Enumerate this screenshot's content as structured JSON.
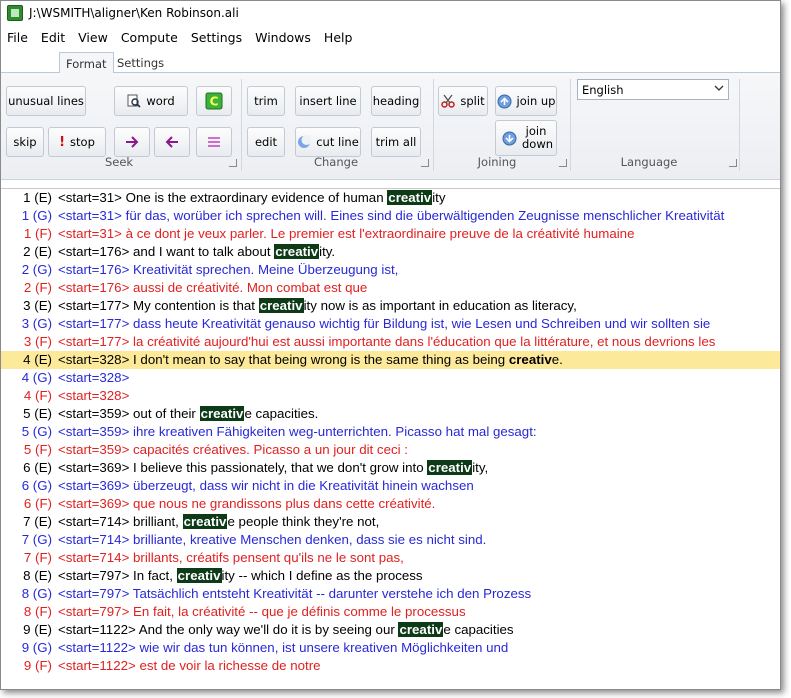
{
  "window": {
    "title": "J:\\WSMITH\\aligner\\Ken Robinson.ali"
  },
  "menu": [
    "File",
    "Edit",
    "View",
    "Compute",
    "Settings",
    "Windows",
    "Help"
  ],
  "tabs": {
    "format": "Format",
    "settings": "Settings"
  },
  "seek": {
    "unusual_lines": "unusual lines",
    "word": "word",
    "skip": "skip",
    "stop": "stop",
    "label": "Seek"
  },
  "change": {
    "trim": "trim",
    "insert_line": "insert line",
    "heading": "heading",
    "edit": "edit",
    "cut_line": "cut line",
    "trim_all": "trim all",
    "label": "Change"
  },
  "joining": {
    "split": "split",
    "join_up": "join up",
    "join_down": "join down",
    "label": "Joining"
  },
  "language": {
    "selected": "English",
    "label": "Language"
  },
  "colors": {
    "english": "#000000",
    "german": "#2828d8",
    "french": "#e12020",
    "highlight_bg": "#0d3a17",
    "selected_row": "#fde99a"
  },
  "rows": [
    {
      "num": "1 (E)",
      "lang": "E",
      "pre": "<start=31> One is the extraordinary evidence of human ",
      "hl": "creativ",
      "post": "ity"
    },
    {
      "num": "1 (G)",
      "lang": "G",
      "pre": "<start=31> für das, worüber ich sprechen will. Eines sind die überwältigenden Zeugnisse menschlicher Kreativität",
      "hl": "",
      "post": ""
    },
    {
      "num": "1 (F)",
      "lang": "F",
      "pre": "<start=31> à ce dont je veux parler. Le premier est l'extraordinaire preuve de la créativité humaine",
      "hl": "",
      "post": ""
    },
    {
      "num": "2 (E)",
      "lang": "E",
      "pre": "<start=176> and I want to talk about ",
      "hl": "creativ",
      "post": "ity."
    },
    {
      "num": "2 (G)",
      "lang": "G",
      "pre": "<start=176> Kreativität sprechen. Meine Überzeugung ist,",
      "hl": "",
      "post": ""
    },
    {
      "num": "2 (F)",
      "lang": "F",
      "pre": "<start=176> aussi de créativité. Mon combat est que",
      "hl": "",
      "post": ""
    },
    {
      "num": "3 (E)",
      "lang": "E",
      "pre": "<start=177> My contention is that ",
      "hl": "creativ",
      "post": "ity now is as important in education as literacy,"
    },
    {
      "num": "3 (G)",
      "lang": "G",
      "pre": "<start=177> dass heute Kreativität genauso wichtig für Bildung ist, wie Lesen und Schreiben und wir sollten sie",
      "hl": "",
      "post": ""
    },
    {
      "num": "3 (F)",
      "lang": "F",
      "pre": "<start=177> la créativité aujourd'hui est aussi importante dans l'éducation que la littérature, et nous devrions les",
      "hl": "",
      "post": ""
    },
    {
      "num": "4 (E)",
      "lang": "E",
      "sel": true,
      "pre": "<start=328> I don't mean to say that being wrong is the same thing as being ",
      "hlplain": "creativ",
      "post": "e."
    },
    {
      "num": "4 (G)",
      "lang": "G",
      "pre": "<start=328>",
      "hl": "",
      "post": ""
    },
    {
      "num": "4 (F)",
      "lang": "F",
      "pre": "<start=328>",
      "hl": "",
      "post": ""
    },
    {
      "num": "5 (E)",
      "lang": "E",
      "pre": "<start=359> out of their ",
      "hl": "creativ",
      "post": "e capacities."
    },
    {
      "num": "5 (G)",
      "lang": "G",
      "pre": "<start=359> ihre kreativen Fähigkeiten weg-unterrichten. Picasso hat mal gesagt:",
      "hl": "",
      "post": ""
    },
    {
      "num": "5 (F)",
      "lang": "F",
      "pre": "<start=359> capacités créatives. Picasso a un jour dit ceci :",
      "hl": "",
      "post": ""
    },
    {
      "num": "6 (E)",
      "lang": "E",
      "pre": "<start=369> I believe this passionately, that we don't grow into ",
      "hl": "creativ",
      "post": "ity,"
    },
    {
      "num": "6 (G)",
      "lang": "G",
      "pre": "<start=369> überzeugt, dass wir nicht in die Kreativität hinein wachsen",
      "hl": "",
      "post": ""
    },
    {
      "num": "6 (F)",
      "lang": "F",
      "pre": "<start=369> que nous ne grandissons plus dans cette créativité.",
      "hl": "",
      "post": ""
    },
    {
      "num": "7 (E)",
      "lang": "E",
      "pre": "<start=714> brilliant, ",
      "hl": "creativ",
      "post": "e people think they're not,"
    },
    {
      "num": "7 (G)",
      "lang": "G",
      "pre": "<start=714> brilliante, kreative Menschen denken, dass sie es nicht sind.",
      "hl": "",
      "post": ""
    },
    {
      "num": "7 (F)",
      "lang": "F",
      "pre": "<start=714> brillants, créatifs pensent qu'ils ne le sont pas,",
      "hl": "",
      "post": ""
    },
    {
      "num": "8 (E)",
      "lang": "E",
      "pre": "<start=797> In fact, ",
      "hl": "creativ",
      "post": "ity -- which I define as the process"
    },
    {
      "num": "8 (G)",
      "lang": "G",
      "pre": "<start=797> Tatsächlich entsteht Kreativität -- darunter verstehe ich den Prozess",
      "hl": "",
      "post": ""
    },
    {
      "num": "8 (F)",
      "lang": "F",
      "pre": "<start=797> En fait, la créativité -- que je définis comme le processus",
      "hl": "",
      "post": ""
    },
    {
      "num": "9 (E)",
      "lang": "E",
      "pre": "<start=1122> And the only way we'll do it is by seeing our ",
      "hl": "creativ",
      "post": "e capacities"
    },
    {
      "num": "9 (G)",
      "lang": "G",
      "pre": "<start=1122> wie wir das tun können, ist unsere kreativen Möglichkeiten und",
      "hl": "",
      "post": ""
    },
    {
      "num": "9 (F)",
      "lang": "F",
      "pre": "<start=1122> est de voir la richesse de notre",
      "hl": "",
      "post": ""
    }
  ]
}
